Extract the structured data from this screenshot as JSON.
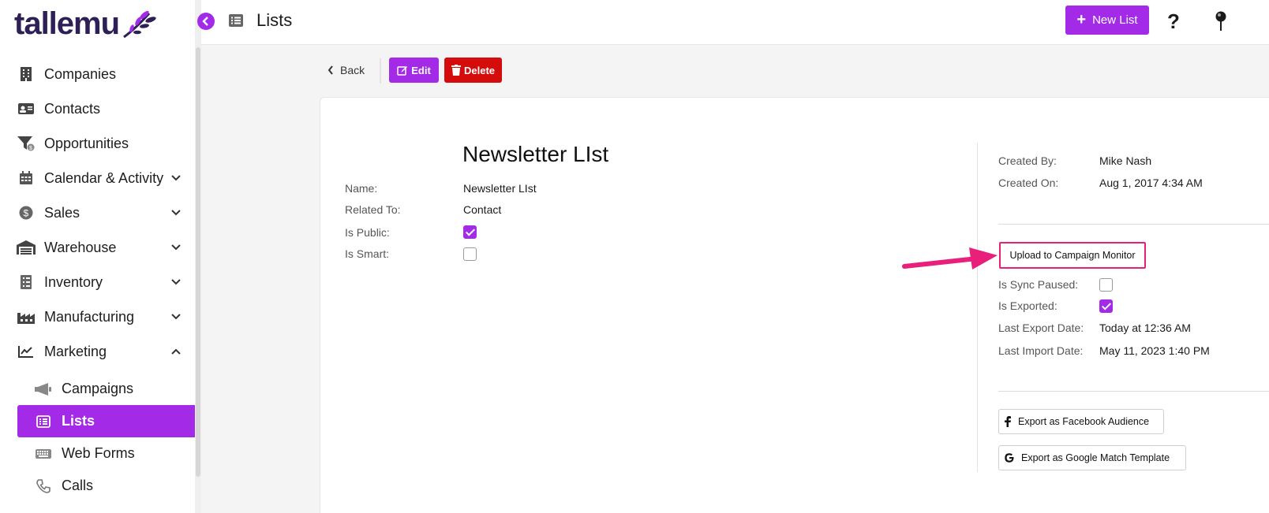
{
  "app": {
    "brand": "tallemu"
  },
  "sidebar": {
    "items": [
      {
        "label": "Companies",
        "icon": "building-icon"
      },
      {
        "label": "Contacts",
        "icon": "id-card-icon"
      },
      {
        "label": "Opportunities",
        "icon": "funnel-dollar-icon"
      },
      {
        "label": "Calendar & Activity",
        "icon": "calendar-icon",
        "expandable": true
      },
      {
        "label": "Sales",
        "icon": "dollar-circle-icon",
        "expandable": true
      },
      {
        "label": "Warehouse",
        "icon": "warehouse-icon",
        "expandable": true
      },
      {
        "label": "Inventory",
        "icon": "checklist-icon",
        "expandable": true
      },
      {
        "label": "Manufacturing",
        "icon": "factory-icon",
        "expandable": true
      },
      {
        "label": "Marketing",
        "icon": "chart-line-icon",
        "expanded": true
      }
    ],
    "marketing_sub": [
      {
        "label": "Campaigns",
        "icon": "megaphone-icon"
      },
      {
        "label": "Lists",
        "icon": "list-icon",
        "active": true
      },
      {
        "label": "Web Forms",
        "icon": "keyboard-icon"
      },
      {
        "label": "Calls",
        "icon": "phone-icon"
      }
    ]
  },
  "header": {
    "title": "Lists",
    "new_button": "New List"
  },
  "actions": {
    "back": "Back",
    "edit": "Edit",
    "delete": "Delete"
  },
  "record": {
    "title": "Newsletter LIst",
    "fields": {
      "name_label": "Name:",
      "name_value": "Newsletter LIst",
      "related_label": "Related To:",
      "related_value": "Contact",
      "public_label": "Is Public:",
      "public_checked": true,
      "smart_label": "Is Smart:",
      "smart_checked": false
    }
  },
  "meta": {
    "created_by_label": "Created By:",
    "created_by_value": "Mike Nash",
    "created_on_label": "Created On:",
    "created_on_value": "Aug 1, 2017 4:34 AM"
  },
  "campaign_monitor": {
    "upload_button": "Upload to Campaign Monitor",
    "sync_paused_label": "Is Sync Paused:",
    "sync_paused_checked": false,
    "exported_label": "Is Exported:",
    "exported_checked": true,
    "last_export_label": "Last Export Date:",
    "last_export_value": "Today at 12:36 AM",
    "last_import_label": "Last Import Date:",
    "last_import_value": "May 11, 2023 1:40 PM"
  },
  "exports": {
    "facebook": "Export as Facebook Audience",
    "google": "Export as Google Match Template"
  },
  "colors": {
    "accent": "#a32be8",
    "danger": "#d40c0c",
    "highlight": "#e8207c",
    "brand_text": "#2e1f57"
  }
}
